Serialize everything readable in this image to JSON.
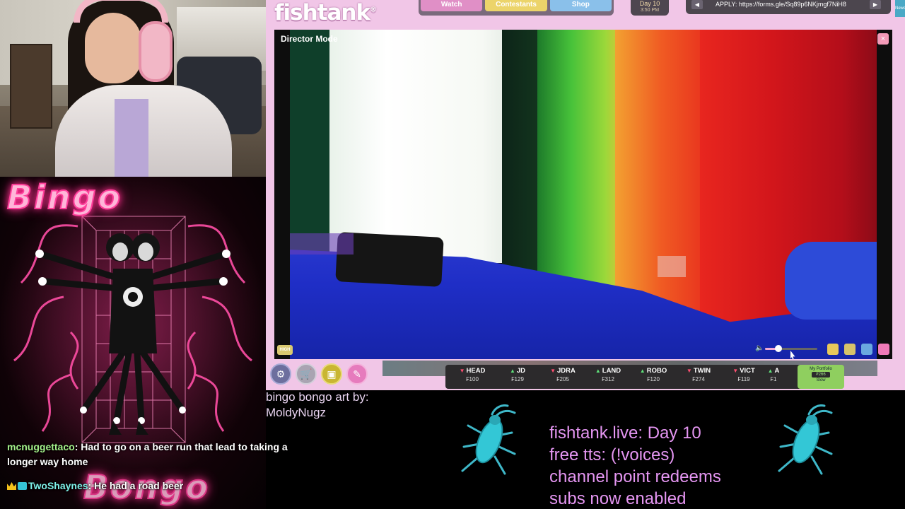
{
  "chat": {
    "messages": [
      {
        "user": "mcnuggettaco",
        "text": ": Had to go on a beer run that lead to taking a longer way home",
        "color": "#a4f08a"
      },
      {
        "user": "TwoShaynes",
        "text": ": He had a road beer",
        "color": "#7ef0e8"
      }
    ]
  },
  "bingo": {
    "top_word": "Bingo",
    "bottom_word": "Bongo"
  },
  "fishtank": {
    "logo": "fishtank",
    "nav": {
      "watch": "Watch",
      "contestants": "Contestants",
      "shop": "Shop"
    },
    "day": {
      "label": "Day 10",
      "time": "3:50 PM"
    },
    "apply_text": "APPLY: https://forms.gle/Sq89p6NKjmgf7NiH8",
    "news_label": "News",
    "player": {
      "title": "Director Mode",
      "close": "×",
      "quality": "HIGH"
    },
    "stocks": [
      {
        "name": "HEAD",
        "dir": "down",
        "price": "₣100"
      },
      {
        "name": "JD",
        "dir": "up",
        "price": "₣129"
      },
      {
        "name": "JDRA",
        "dir": "down",
        "price": "₣205"
      },
      {
        "name": "LAND",
        "dir": "up",
        "price": "₣312"
      },
      {
        "name": "ROBO",
        "dir": "up",
        "price": "₣120"
      },
      {
        "name": "TWIN",
        "dir": "down",
        "price": "₣274"
      },
      {
        "name": "VICT",
        "dir": "down",
        "price": "₣119"
      },
      {
        "name": "A",
        "dir": "up",
        "price": "₣1"
      }
    ],
    "portfolio": {
      "label": "My Portfolio",
      "value": "₣266",
      "action": "Slow"
    },
    "volume_level": 0.25,
    "colors": {
      "accent": "#f1c6e7",
      "up": "#5fe07a",
      "down": "#ff4f72"
    }
  },
  "overlay": {
    "art_credit_line1": "bingo bongo art by:",
    "art_credit_line2": "MoldyNugz",
    "info_lines": [
      "fishtank.live: Day 10",
      "free tts: (!voices)",
      "channel point redeems",
      "subs now enabled"
    ]
  }
}
